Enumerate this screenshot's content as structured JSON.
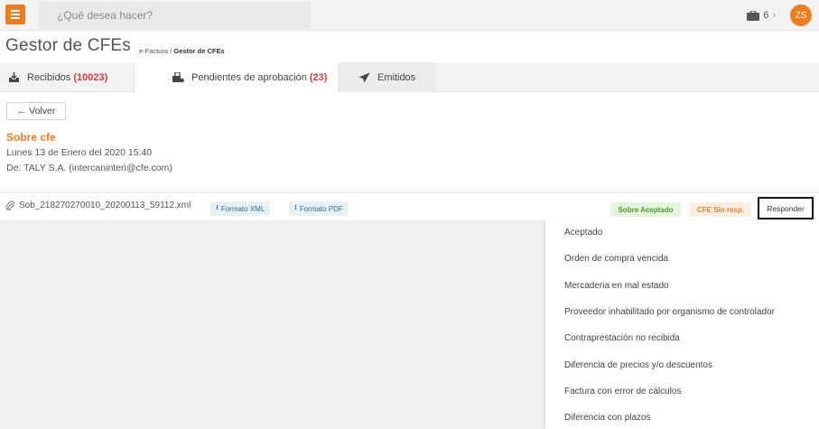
{
  "topbar": {
    "search_placeholder": "¿Qué desea hacer?",
    "briefcase_count": "6",
    "avatar_initials": "ZS",
    "accent_color": "#f07d1d"
  },
  "header": {
    "title": "Gestor de CFEs",
    "breadcrumb_root": "e-Factura",
    "breadcrumb_sep": " / ",
    "breadcrumb_current": "Gestor de CFEs"
  },
  "tabs": [
    {
      "label": "Recibidos",
      "count": "(10023)",
      "icon": "inbox-download-icon"
    },
    {
      "label": "Pendientes de aprobación",
      "count": "(23)",
      "icon": "pending-approval-icon"
    },
    {
      "label": "Emitidos",
      "count": "",
      "icon": "paper-plane-icon"
    }
  ],
  "detail": {
    "back_label": "Volver",
    "sobre_title": "Sobre cfe",
    "date": "Lunes 13 de Enero del 2020 15:40",
    "from": "De: TALY S.A. (intercaninteri@cfe.com)"
  },
  "file": {
    "name": "Sob_218270270010_20200113_59112.xml",
    "xml_label": "Formato XML",
    "pdf_label": "Formato PDF"
  },
  "status": {
    "sobre_aceptado": "Sobre Aceptado",
    "cfe_sin_resp": "CFE Sin resp.",
    "responder_label": "Responder"
  },
  "responder_menu": [
    "Aceptado",
    "Orden de compra vencida",
    "Mercaderia en mal estado",
    "Proveedor inhabilitado por organismo de controlador",
    "Contraprestación no recibida",
    "Diferencia de precios y/o descuentos",
    "Factura con error de cálculos",
    "Diferencia con plazos"
  ]
}
